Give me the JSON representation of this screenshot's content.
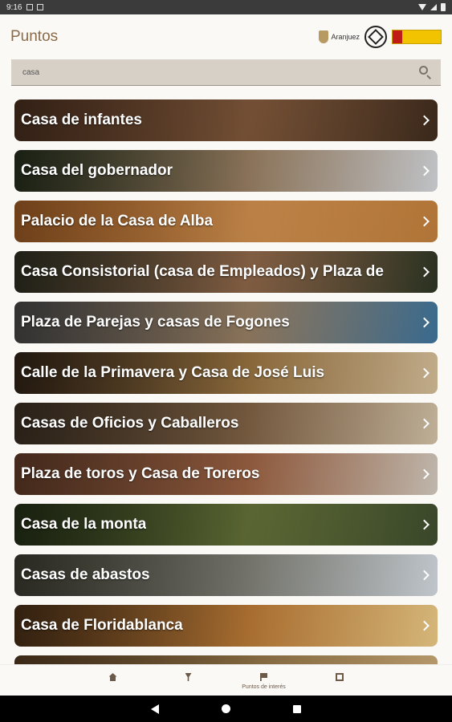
{
  "status_bar": {
    "time": "9:16"
  },
  "header": {
    "title": "Puntos",
    "logos": [
      "Aranjuez"
    ]
  },
  "search": {
    "value": "casa"
  },
  "points": [
    {
      "label": "Casa de infantes",
      "colors": [
        "#5c3a26",
        "#8a5f3f",
        "#3d2a1c"
      ]
    },
    {
      "label": "Casa del gobernador",
      "colors": [
        "#2f3a24",
        "#a5896a",
        "#c9ccd0"
      ]
    },
    {
      "label": "Palacio de la Casa de Alba",
      "colors": [
        "#c8742e",
        "#e09a54",
        "#b97a3a"
      ]
    },
    {
      "label": "Casa Consistorial (casa de Empleados) y Plaza de",
      "colors": [
        "#3a3a2a",
        "#9a6f4f",
        "#2b3322"
      ]
    },
    {
      "label": "Plaza de Parejas y casas de Fogones",
      "colors": [
        "#5a5a5a",
        "#a58a6c",
        "#3c6f95"
      ]
    },
    {
      "label": "Calle de la Primavera y Casa de José Luis",
      "colors": [
        "#3e2c1c",
        "#a47c46",
        "#cbb592"
      ]
    },
    {
      "label": "Casas de Oficios y Caballeros",
      "colors": [
        "#4a3a2a",
        "#8a6a4a",
        "#c9b9a0"
      ]
    },
    {
      "label": "Plaza de toros y Casa de Toreros",
      "colors": [
        "#7a4a32",
        "#a86a48",
        "#c9c0b5"
      ]
    },
    {
      "label": "Casa de la monta",
      "colors": [
        "#2c3a1c",
        "#6c7a3c",
        "#3c4a2c"
      ]
    },
    {
      "label": "Casas de abastos",
      "colors": [
        "#4a4a3c",
        "#8a8a80",
        "#c9d0d6"
      ]
    },
    {
      "label": "Casa de Floridablanca",
      "colors": [
        "#5a3a1c",
        "#c9833a",
        "#e0c080"
      ]
    },
    {
      "label": "",
      "colors": [
        "#6a4a2a",
        "#9a7a4a",
        "#bfa070"
      ]
    }
  ],
  "bottom_nav": {
    "items": [
      {
        "label": "",
        "icon": "home-icon"
      },
      {
        "label": "",
        "icon": "pin-icon"
      },
      {
        "label": "Puntos de interés",
        "icon": "flag-icon"
      },
      {
        "label": "",
        "icon": "qr-icon"
      }
    ]
  }
}
